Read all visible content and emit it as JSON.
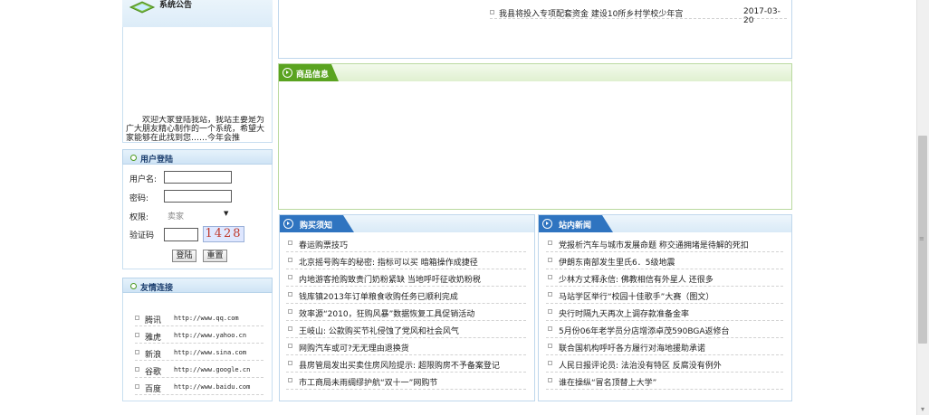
{
  "notice": {
    "title": "系统公告",
    "text": "欢迎大家登陆我站，我站主要是为广大朋友精心制作的一个系统，希望大家能够在此找到您……今年会推"
  },
  "login": {
    "title": "用户登陆",
    "username_label": "用户名:",
    "password_label": "密码:",
    "role_label": "权限:",
    "role_value": "卖家",
    "captcha_label": "验证码",
    "captcha_code": "1428",
    "login_button": "登陆",
    "reset_button": "重置"
  },
  "friend_links": {
    "title": "友情连接",
    "items": [
      {
        "name": "腾讯",
        "url": "http://www.qq.com"
      },
      {
        "name": "雅虎",
        "url": "http://www.yahoo.cn"
      },
      {
        "name": "新浪",
        "url": "http://www.sina.com"
      },
      {
        "name": "谷歌",
        "url": "http://www.google.cn"
      },
      {
        "name": "百度",
        "url": "http://www.baidu.com"
      }
    ]
  },
  "top_news": {
    "title": "我县将投入专项配套资金 建设10所乡村学校少年宫",
    "date": "2017-03-20"
  },
  "goods": {
    "title": "商品信息"
  },
  "purchase_notice": {
    "title": "购买须知",
    "items": [
      "春运购票技巧",
      "北京摇号购车的秘密: 指标可以买 暗箱操作成捷径",
      "内地游客抢购致贵门奶粉紧缺 当地呼吁征收奶粉税",
      "钱库镇2013年订单粮食收购任务已顺利完成",
      "效率源“2010，狂购风暴”数据恢复工具促销活动",
      "王岐山: 公款购买节礼侵蚀了党风和社会风气",
      "网购汽车或可?无无理由退换货",
      "县房管局发出买卖住房风险提示: 超限购房不予备案登记",
      "市工商局未雨绸缪护航“双十一”网购节"
    ]
  },
  "site_news": {
    "title": "站内新闻",
    "items": [
      "党报析汽车与城市发展命题 称交通拥堵是待解的死扣",
      "伊朗东南部发生里氏6．5级地震",
      "少林方丈释永信: 佛教相信有外星人 还很多",
      "马站学区举行“校园十佳歌手”大赛（图文）",
      "央行时隔九天再次上调存款准备金率",
      "5月份06年老学员分店增添卓茂590BGA返修台",
      "联合国机构呼吁各方履行对海地援助承诺",
      "人民日报评论员: 法治没有特区 反腐没有例外",
      "谁在操纵“冒名顶替上大学”"
    ]
  },
  "colors": {
    "panel_border": "#bfd7ec",
    "tab_blue": "#2f74c0",
    "tab_green": "#5aa320",
    "captcha_bg": "#dfe7ff"
  }
}
